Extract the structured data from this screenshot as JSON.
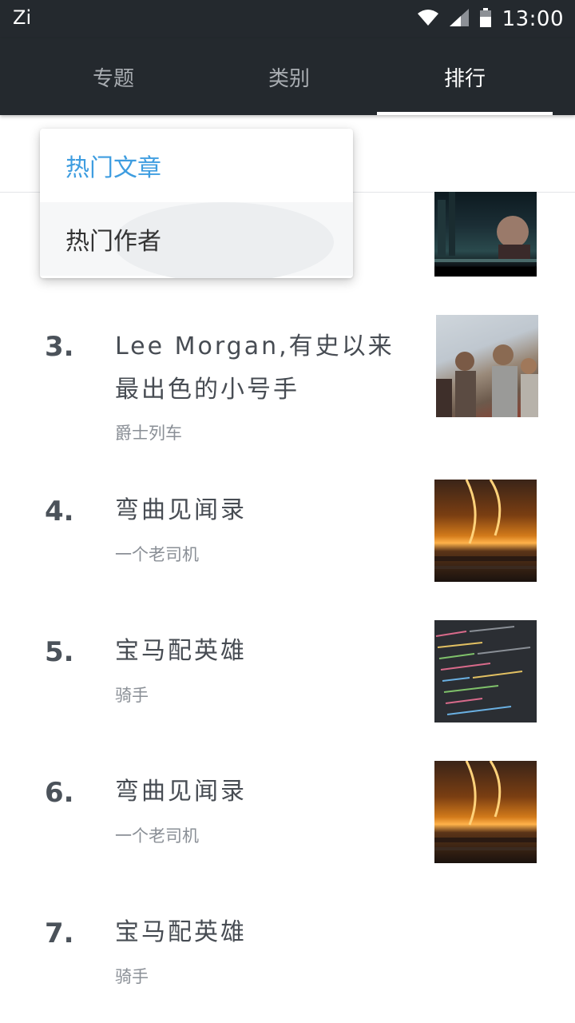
{
  "status_bar": {
    "app_label": "Zi",
    "time": "13:00"
  },
  "tabs": [
    {
      "label": "专题"
    },
    {
      "label": "类别"
    },
    {
      "label": "排行",
      "active": true
    }
  ],
  "dropdown": {
    "items": [
      {
        "label": "热门文章",
        "selected": true
      },
      {
        "label": "热门作者"
      }
    ]
  },
  "articles": [
    {
      "rank": "3.",
      "title": "Lee Morgan,有史以来最出色的小号手",
      "author": "爵士列车",
      "thumb": "crowd-photo"
    },
    {
      "rank": "4.",
      "title": "弯曲见闻录",
      "author": "一个老司机",
      "thumb": "golden-city-photo"
    },
    {
      "rank": "5.",
      "title": "宝马配英雄",
      "author": "骑手",
      "thumb": "code-screen-photo"
    },
    {
      "rank": "6.",
      "title": "弯曲见闻录",
      "author": "一个老司机",
      "thumb": "golden-city-photo"
    },
    {
      "rank": "7.",
      "title": "宝马配英雄",
      "author": "骑手",
      "thumb": ""
    }
  ],
  "colors": {
    "toolbar_bg": "#24292e",
    "accent": "#3e9de0",
    "text": "#474c53",
    "muted": "#8a8f96"
  }
}
